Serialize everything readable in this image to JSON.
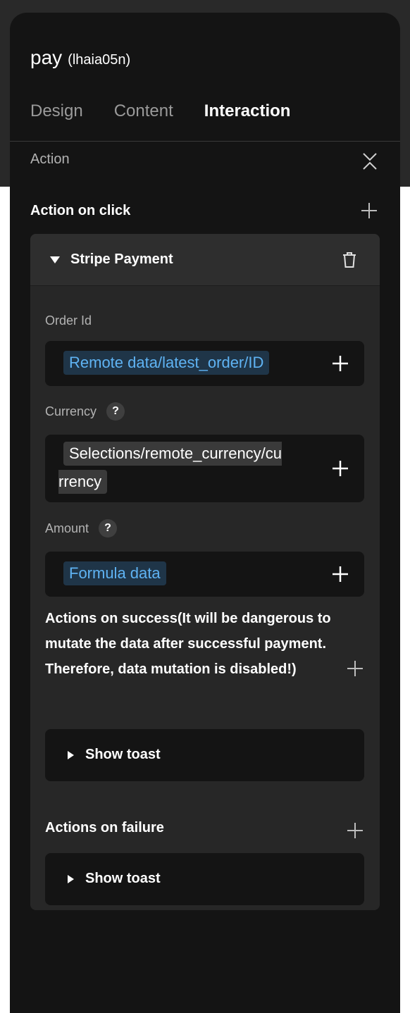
{
  "component": {
    "name": "pay",
    "id": "(lhaia05n)"
  },
  "tabs": [
    {
      "label": "Design",
      "active": false
    },
    {
      "label": "Content",
      "active": false
    },
    {
      "label": "Interaction",
      "active": true
    }
  ],
  "section": {
    "label": "Action"
  },
  "action_on_click": {
    "label": "Action on click",
    "card": {
      "title": "Stripe Payment",
      "fields": {
        "order_id": {
          "label": "Order Id",
          "value": "Remote data/latest_order/ID"
        },
        "currency": {
          "label": "Currency",
          "help": "?",
          "value_line1": "Selections/remote_currency/cu",
          "value_line2": "rrency"
        },
        "amount": {
          "label": "Amount",
          "help": "?",
          "value": "Formula data"
        }
      },
      "success": {
        "label": "Actions on success(It will be dangerous to mutate the data after successful payment. Therefore, data mutation is disabled!)",
        "action": "Show toast"
      },
      "failure": {
        "label": "Actions on failure",
        "action": "Show toast"
      }
    }
  },
  "colors": {
    "panel_bg": "#141414",
    "card_bg": "#272727",
    "chip_blue_text": "#5fb3f3",
    "chip_blue_bg": "#1f3548",
    "chip_gray_bg": "#3a3a3a",
    "muted_text": "#b3b3b3"
  },
  "icons": {
    "collapse": "collapse-chevrons-icon",
    "add": "plus-icon",
    "delete": "trash-icon",
    "help": "question-icon",
    "expand": "caret-down-icon",
    "collapsed": "caret-right-icon"
  }
}
